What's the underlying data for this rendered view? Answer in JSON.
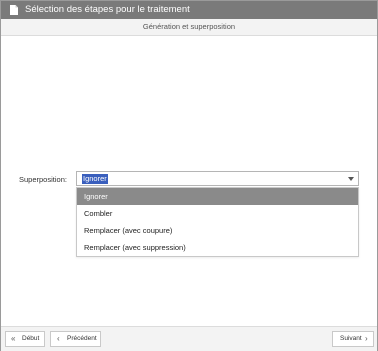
{
  "window": {
    "title": "Sélection des étapes pour le traitement",
    "title_icon": "document-icon",
    "titlebar_color": "#7a7a7a"
  },
  "section": {
    "header": "Génération et superposition"
  },
  "superposition": {
    "label": "Superposition:",
    "selected_value": "Ignorer",
    "highlight_color": "#3a5fbd",
    "options": [
      {
        "label": "Ignorer",
        "highlighted": true
      },
      {
        "label": "Combler",
        "highlighted": false
      },
      {
        "label": "Remplacer (avec coupure)",
        "highlighted": false
      },
      {
        "label": "Remplacer (avec suppression)",
        "highlighted": false
      }
    ]
  },
  "footer": {
    "debut_label": "Début",
    "debut_icon": "double-chevron-left-icon",
    "precedent_label": "Précédent",
    "precedent_icon": "chevron-left-icon",
    "suivant_label": "Suivant",
    "suivant_icon": "chevron-right-icon"
  }
}
